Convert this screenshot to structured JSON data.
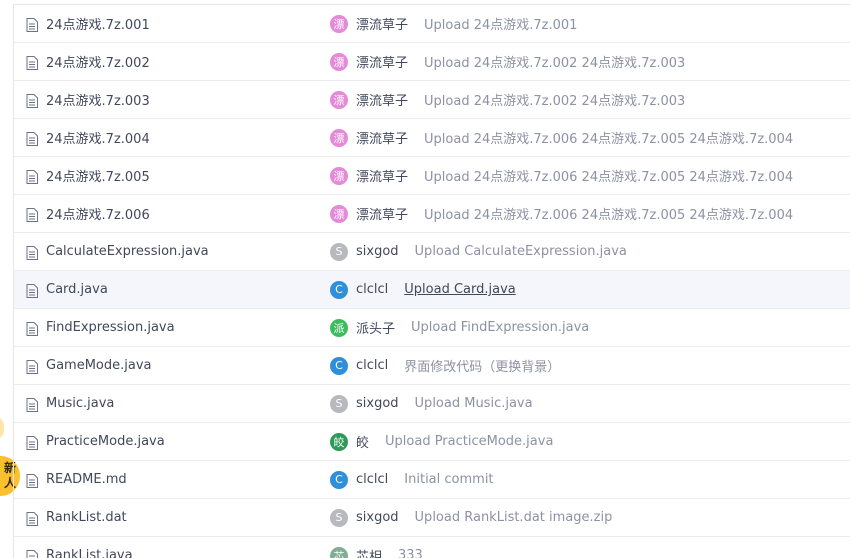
{
  "files": [
    {
      "name": "24点游戏.7z.001",
      "author": "漂流草子",
      "avatar_letter": "漂",
      "avatar_color": "#e58ad9",
      "message": "Upload 24点游戏.7z.001",
      "underline": false
    },
    {
      "name": "24点游戏.7z.002",
      "author": "漂流草子",
      "avatar_letter": "漂",
      "avatar_color": "#e58ad9",
      "message": "Upload 24点游戏.7z.002 24点游戏.7z.003",
      "underline": false
    },
    {
      "name": "24点游戏.7z.003",
      "author": "漂流草子",
      "avatar_letter": "漂",
      "avatar_color": "#e58ad9",
      "message": "Upload 24点游戏.7z.002 24点游戏.7z.003",
      "underline": false
    },
    {
      "name": "24点游戏.7z.004",
      "author": "漂流草子",
      "avatar_letter": "漂",
      "avatar_color": "#e58ad9",
      "message": "Upload 24点游戏.7z.006 24点游戏.7z.005 24点游戏.7z.004",
      "underline": false
    },
    {
      "name": "24点游戏.7z.005",
      "author": "漂流草子",
      "avatar_letter": "漂",
      "avatar_color": "#e58ad9",
      "message": "Upload 24点游戏.7z.006 24点游戏.7z.005 24点游戏.7z.004",
      "underline": false
    },
    {
      "name": "24点游戏.7z.006",
      "author": "漂流草子",
      "avatar_letter": "漂",
      "avatar_color": "#e58ad9",
      "message": "Upload 24点游戏.7z.006 24点游戏.7z.005 24点游戏.7z.004",
      "underline": false
    },
    {
      "name": "CalculateExpression.java",
      "author": "sixgod",
      "avatar_letter": "S",
      "avatar_color": "#b7b9bf",
      "message": "Upload CalculateExpression.java",
      "underline": false
    },
    {
      "name": "Card.java",
      "author": "clclcl",
      "avatar_letter": "C",
      "avatar_color": "#2f8fd8",
      "message": "Upload Card.java",
      "underline": true
    },
    {
      "name": "FindExpression.java",
      "author": "派头子",
      "avatar_letter": "派",
      "avatar_color": "#3dbb5e",
      "message": "Upload FindExpression.java",
      "underline": false
    },
    {
      "name": "GameMode.java",
      "author": "clclcl",
      "avatar_letter": "C",
      "avatar_color": "#2f8fd8",
      "message": "界面修改代码（更换背景）",
      "underline": false
    },
    {
      "name": "Music.java",
      "author": "sixgod",
      "avatar_letter": "S",
      "avatar_color": "#b7b9bf",
      "message": "Upload Music.java",
      "underline": false
    },
    {
      "name": "PracticeMode.java",
      "author": "皎",
      "avatar_letter": "皎",
      "avatar_color": "#2e9a57",
      "message": "Upload PracticeMode.java",
      "underline": false
    },
    {
      "name": "README.md",
      "author": "clclcl",
      "avatar_letter": "C",
      "avatar_color": "#2f8fd8",
      "message": "Initial commit",
      "underline": false
    },
    {
      "name": "RankList.dat",
      "author": "sixgod",
      "avatar_letter": "S",
      "avatar_color": "#b7b9bf",
      "message": "Upload RankList.dat image.zip",
      "underline": false
    },
    {
      "name": "RankList.java",
      "author": "芯相",
      "avatar_letter": "芯",
      "avatar_color": "#7fae94",
      "message": "333",
      "underline": false
    }
  ],
  "highlighted_row": 7,
  "side_badge": {
    "line1": "新",
    "line2": "人"
  }
}
